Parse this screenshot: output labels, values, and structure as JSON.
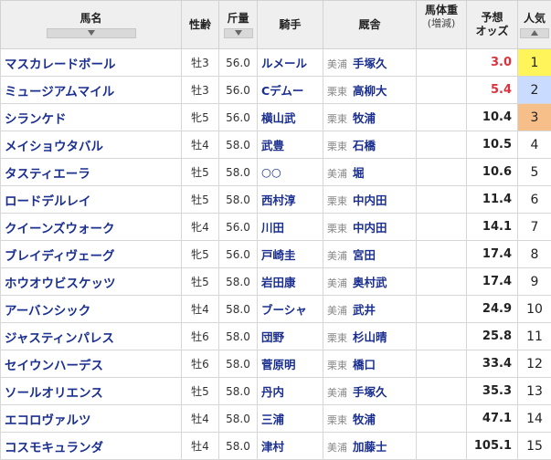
{
  "headers": {
    "name": "馬名",
    "age": "性齢",
    "weight": "斤量",
    "jockey": "騎手",
    "stable": "厩舎",
    "bodyweight": "馬体重",
    "bodyweight_sub": "(増減)",
    "odds_line1": "予想",
    "odds_line2": "オッズ",
    "popularity": "人気"
  },
  "colors": {
    "link": "#1a2f8f",
    "hot_odds": "#d9333f",
    "pop1": "#fff45a",
    "pop2": "#c9dcff",
    "pop3": "#f6bf8a"
  },
  "rows": [
    {
      "name": "マスカレードボール",
      "age": "牡3",
      "weight": "56.0",
      "jockey": "ルメール",
      "area": "美浦",
      "trainer": "手塚久",
      "odds": "3.0",
      "pop": "1"
    },
    {
      "name": "ミュージアムマイル",
      "age": "牡3",
      "weight": "56.0",
      "jockey": "Cデムー",
      "area": "栗東",
      "trainer": "高柳大",
      "odds": "5.4",
      "pop": "2"
    },
    {
      "name": "シランケド",
      "age": "牝5",
      "weight": "56.0",
      "jockey": "横山武",
      "area": "栗東",
      "trainer": "牧浦",
      "odds": "10.4",
      "pop": "3"
    },
    {
      "name": "メイショウタバル",
      "age": "牡4",
      "weight": "58.0",
      "jockey": "武豊",
      "area": "栗東",
      "trainer": "石橋",
      "odds": "10.5",
      "pop": "4"
    },
    {
      "name": "タスティエーラ",
      "age": "牡5",
      "weight": "58.0",
      "jockey": "○○",
      "area": "美浦",
      "trainer": "堀",
      "odds": "10.6",
      "pop": "5"
    },
    {
      "name": "ロードデルレイ",
      "age": "牡5",
      "weight": "58.0",
      "jockey": "西村淳",
      "area": "栗東",
      "trainer": "中内田",
      "odds": "11.4",
      "pop": "6"
    },
    {
      "name": "クイーンズウォーク",
      "age": "牝4",
      "weight": "56.0",
      "jockey": "川田",
      "area": "栗東",
      "trainer": "中内田",
      "odds": "14.1",
      "pop": "7"
    },
    {
      "name": "ブレイディヴェーグ",
      "age": "牝5",
      "weight": "56.0",
      "jockey": "戸崎圭",
      "area": "美浦",
      "trainer": "宮田",
      "odds": "17.4",
      "pop": "8"
    },
    {
      "name": "ホウオウビスケッツ",
      "age": "牡5",
      "weight": "58.0",
      "jockey": "岩田康",
      "area": "美浦",
      "trainer": "奥村武",
      "odds": "17.4",
      "pop": "9"
    },
    {
      "name": "アーバンシック",
      "age": "牡4",
      "weight": "58.0",
      "jockey": "ブーシャ",
      "area": "美浦",
      "trainer": "武井",
      "odds": "24.9",
      "pop": "10"
    },
    {
      "name": "ジャスティンパレス",
      "age": "牡6",
      "weight": "58.0",
      "jockey": "団野",
      "area": "栗東",
      "trainer": "杉山晴",
      "odds": "25.8",
      "pop": "11"
    },
    {
      "name": "セイウンハーデス",
      "age": "牡6",
      "weight": "58.0",
      "jockey": "菅原明",
      "area": "栗東",
      "trainer": "橋口",
      "odds": "33.4",
      "pop": "12"
    },
    {
      "name": "ソールオリエンス",
      "age": "牡5",
      "weight": "58.0",
      "jockey": "丹内",
      "area": "美浦",
      "trainer": "手塚久",
      "odds": "35.3",
      "pop": "13"
    },
    {
      "name": "エコロヴァルツ",
      "age": "牡4",
      "weight": "58.0",
      "jockey": "三浦",
      "area": "栗東",
      "trainer": "牧浦",
      "odds": "47.1",
      "pop": "14"
    },
    {
      "name": "コスモキュランダ",
      "age": "牡4",
      "weight": "58.0",
      "jockey": "津村",
      "area": "美浦",
      "trainer": "加藤士",
      "odds": "105.1",
      "pop": "15"
    }
  ]
}
